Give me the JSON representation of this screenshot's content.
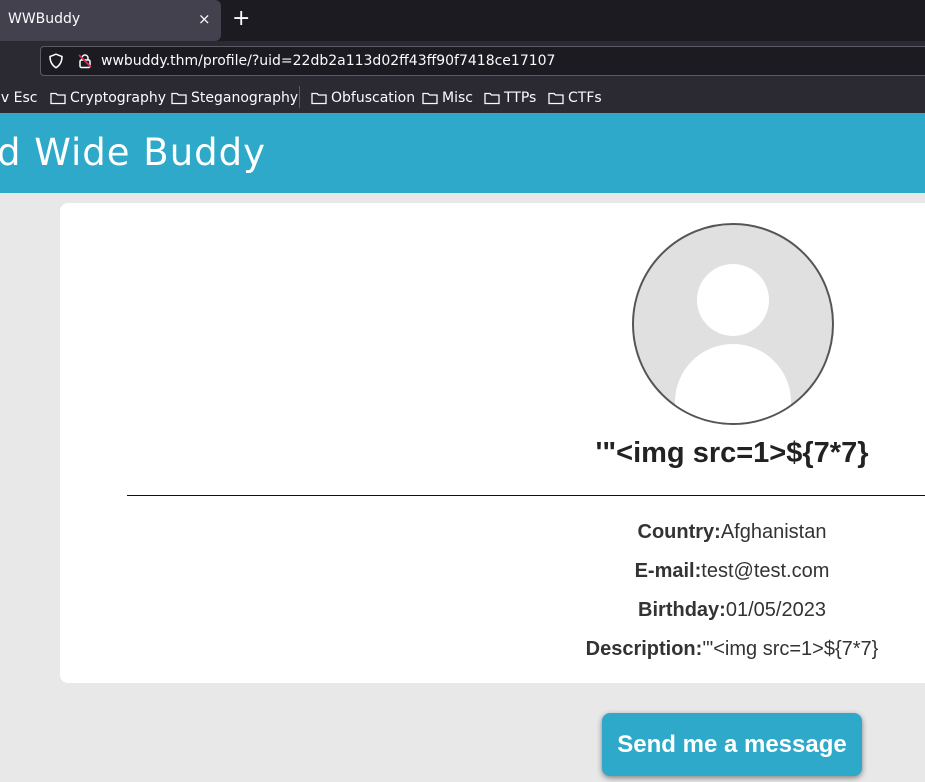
{
  "browser": {
    "tab_title": "WWBuddy",
    "tab_close": "×",
    "new_tab": "+",
    "url": "wwbuddy.thm/profile/?uid=22db2a113d02ff43ff90f7418ce17107",
    "bookmarks": [
      {
        "label": "iv Esc",
        "icon": ""
      },
      {
        "label": "Cryptography",
        "icon": "folder-icon"
      },
      {
        "label": "Steganography",
        "icon": "folder-icon"
      },
      {
        "label": "Obfuscation",
        "icon": "folder-icon"
      },
      {
        "label": "Misc",
        "icon": "folder-icon"
      },
      {
        "label": "TTPs",
        "icon": "folder-icon"
      },
      {
        "label": "CTFs",
        "icon": "folder-icon"
      }
    ]
  },
  "site": {
    "title": "d Wide Buddy",
    "accent_color": "#2ea9c9"
  },
  "profile": {
    "name": "'\"<img src=1>${7*7}",
    "fields": [
      {
        "label": "Country:",
        "value": "Afghanistan"
      },
      {
        "label": "E-mail:",
        "value": "test@test.com"
      },
      {
        "label": "Birthday:",
        "value": "01/05/2023"
      },
      {
        "label": "Description:",
        "value": "'\"<img src=1>${7*7}"
      }
    ]
  },
  "actions": {
    "send_message": "Send me a message"
  }
}
